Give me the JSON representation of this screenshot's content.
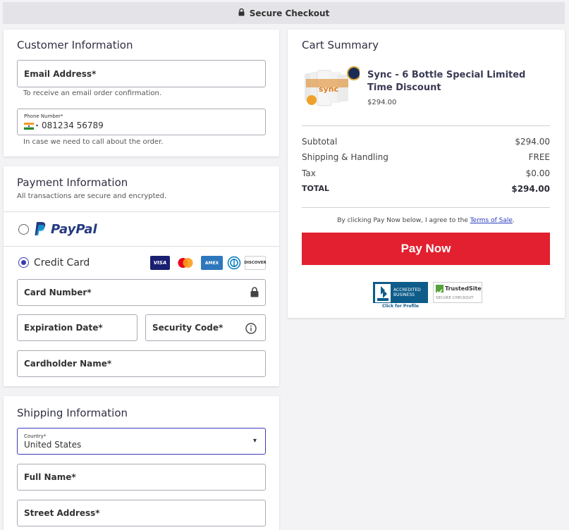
{
  "topbar": {
    "label": "Secure Checkout"
  },
  "customer": {
    "title": "Customer Information",
    "email_label": "Email Address*",
    "email_help": "To receive an email order confirmation.",
    "phone_label": "Phone Number*",
    "phone_value": "081234 56789",
    "phone_help": "In case we need to call about the order."
  },
  "payment": {
    "title": "Payment Information",
    "subtitle": "All transactions are secure and encrypted.",
    "paypal_label": "PayPal",
    "credit_label": "Credit Card",
    "card_brands": [
      "VISA",
      "MC",
      "AMEX",
      "DINERS",
      "DISCOVER"
    ],
    "card_number_label": "Card Number*",
    "expiration_label": "Expiration Date*",
    "security_label": "Security Code*",
    "cardholder_label": "Cardholder Name*"
  },
  "shipping": {
    "title": "Shipping Information",
    "country_label": "Country*",
    "country_value": "United States",
    "fullname_label": "Full Name*",
    "street_label": "Street Address*"
  },
  "cart": {
    "title": "Cart Summary",
    "product_name": "Sync - 6 Bottle Special Limited Time Discount",
    "product_price": "$294.00",
    "rows": [
      {
        "label": "Subtotal",
        "value": "$294.00"
      },
      {
        "label": "Shipping & Handling",
        "value": "FREE"
      },
      {
        "label": "Tax",
        "value": "$0.00"
      },
      {
        "label": "TOTAL",
        "value": "$294.00"
      }
    ],
    "terms_prefix": "By clicking Pay Now below, I agree to the ",
    "terms_link": "Terms of Sale",
    "terms_suffix": ".",
    "pay_button": "Pay Now",
    "bbb_line1": "ACCREDITED",
    "bbb_line2": "BUSINESS",
    "bbb_sub": "Click for Profile",
    "trusted_name": "TrustedSite",
    "trusted_sub": "SECURE CHECKOUT"
  },
  "colors": {
    "accent": "#3b3bb8",
    "pay": "#e3202f",
    "paypal_dark": "#253b80",
    "paypal_light": "#179bd7"
  }
}
